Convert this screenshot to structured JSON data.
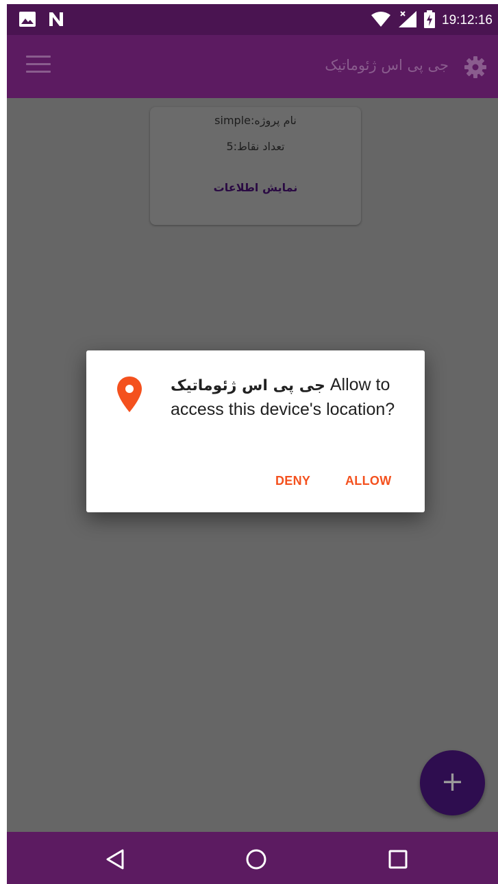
{
  "status_bar": {
    "time": "19:12:16",
    "left_icons": [
      "image-icon",
      "n-logo-icon"
    ],
    "right_icons": [
      "wifi-icon",
      "cell-signal-icon",
      "battery-charging-icon"
    ]
  },
  "app_bar": {
    "title": "جی پی اس ژئوماتیک",
    "menu_icon": "hamburger-menu-icon",
    "settings_icon": "gear-icon"
  },
  "project_card": {
    "name_line": "نام پروژه:simple",
    "points_line": "تعداد نقاط:5",
    "show_info_link": "نمایش اطلاعات"
  },
  "permission_dialog": {
    "icon": "location-pin-icon",
    "app_name": "جی پی اس ژئوماتیک",
    "prefix": "Allow",
    "message": "to access this device's location?",
    "deny_label": "DENY",
    "allow_label": "ALLOW"
  },
  "fab": {
    "label": "+",
    "icon": "add-icon"
  },
  "nav_bar": {
    "buttons": [
      "back-icon",
      "home-icon",
      "recents-icon"
    ]
  },
  "colors": {
    "status_bar": "#4a1451",
    "app_bar": "#5c1b61",
    "scrim_background": "#666666",
    "accent": "#f4511e",
    "fab": "#2e0d4f"
  }
}
